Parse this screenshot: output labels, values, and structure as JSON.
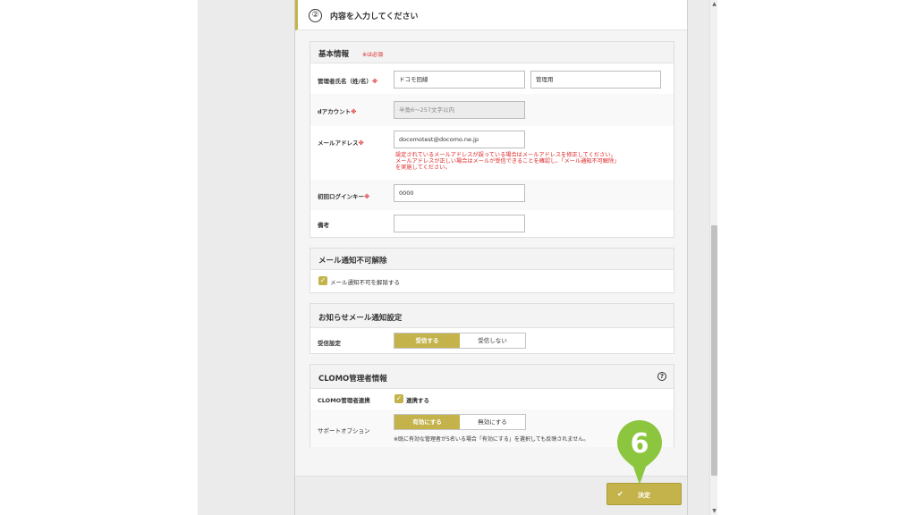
{
  "panel": {
    "step_number": "②",
    "title": "内容を入力してください"
  },
  "basic_info": {
    "title": "基本情報",
    "required_note": "※は必須",
    "fields": {
      "name_label": "管理者氏名（姓/名）",
      "name_req": "※",
      "last_name_value": "ドコモ回線",
      "first_name_value": "管理用",
      "daccount_label": "dアカウント",
      "daccount_req": "※",
      "daccount_placeholder": "半角6～257文字以内",
      "email_label": "メールアドレス",
      "email_req": "※",
      "email_value": "docomotest@docomo.ne.jp",
      "email_warning_1": "設定されているメールアドレスが誤っている場合はメールアドレスを修正してください。",
      "email_warning_2": "メールアドレスが正しい場合はメールが受信できることを確認し、「メール通知不可解除」",
      "email_warning_3": "を実施してください。",
      "login_key_label": "初回ログインキー",
      "login_key_req": "※",
      "login_key_value": "0000",
      "remarks_label": "備考",
      "remarks_value": ""
    }
  },
  "mail_block": {
    "title": "メール通知不可解除",
    "checkbox_label": "メール通知不可を解除する",
    "checked": true
  },
  "notice": {
    "title": "お知らせメール通知設定",
    "row_label": "受信設定",
    "options": [
      "受信する",
      "受信しない"
    ],
    "selected": "受信する"
  },
  "clomo": {
    "title": "CLOMO管理者情報",
    "link_label": "CLOMO管理者連携",
    "link_checkbox": "連携する",
    "link_checked": true,
    "support_label": "サポートオプション",
    "support_options": [
      "有効にする",
      "無効にする"
    ],
    "support_selected": "有効にする",
    "support_note": "※既に有効な管理者が5名いる場合「有効にする」を選択しても反映されません。"
  },
  "footer": {
    "confirm_label": "決定"
  },
  "step_marker": {
    "number": "6"
  },
  "colors": {
    "accent": "#c4b34a",
    "marker": "#8cc63f",
    "required": "#dd2222"
  }
}
